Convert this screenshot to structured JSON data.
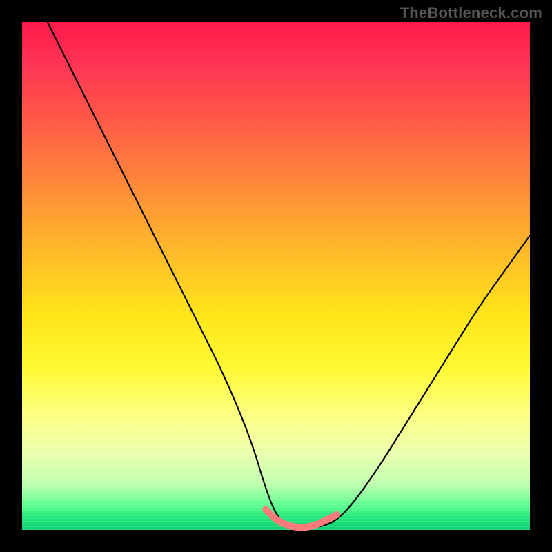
{
  "watermark": "TheBottleneck.com",
  "chart_data": {
    "type": "line",
    "title": "",
    "xlabel": "",
    "ylabel": "",
    "xlim": [
      0,
      100
    ],
    "ylim": [
      0,
      100
    ],
    "series": [
      {
        "name": "bottleneck-curve",
        "color": "#000000",
        "x": [
          5,
          10,
          15,
          20,
          25,
          30,
          35,
          40,
          45,
          48,
          50,
          52,
          54,
          56,
          58,
          60,
          62,
          65,
          70,
          75,
          80,
          85,
          90,
          95,
          100
        ],
        "y": [
          100,
          90,
          80,
          70,
          60,
          50,
          40,
          30,
          18,
          8,
          3,
          1,
          0.5,
          0.5,
          0.5,
          1,
          2,
          5,
          12,
          20,
          28,
          36,
          44,
          51,
          58
        ]
      },
      {
        "name": "optimal-range-marker",
        "color": "#ff7a7a",
        "x": [
          48,
          50,
          52,
          54,
          56,
          58,
          60,
          62
        ],
        "y": [
          4,
          2,
          1,
          0.5,
          0.5,
          1,
          2,
          3
        ]
      }
    ],
    "notes": "V-shaped bottleneck percentage curve on a red-to-green gradient. Minimum (optimal point) near x≈55 at y≈0. Pink segment highlights the near-zero-bottleneck region."
  }
}
